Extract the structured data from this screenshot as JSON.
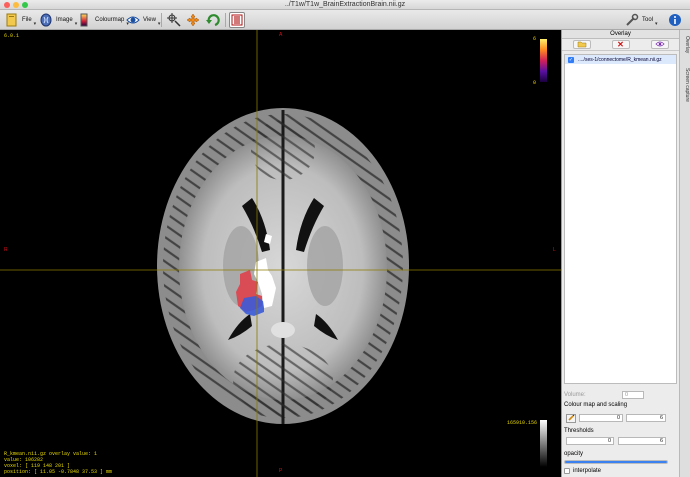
{
  "window": {
    "title": "../T1w/T1w_BrainExtractionBrain.nii.gz"
  },
  "toolbar": {
    "file_label": "File",
    "image_label": "Image",
    "colourmap_label": "Colourmap",
    "view_label": "View",
    "tool_label": "Tool",
    "icons": [
      "file-icon",
      "image-icon",
      "colourmap-icon",
      "view-icon",
      "crosshair-tool-icon",
      "pan-tool-icon",
      "rotate-tool-icon",
      "capture-icon",
      "tool-icon",
      "info-icon"
    ]
  },
  "viewer": {
    "version": "6.0.1",
    "orient_top": "A",
    "orient_left": "R",
    "orient_right": "L",
    "orient_bottom": "P",
    "colourbar_max": "6",
    "colourbar_min": "0",
    "greybar_max": "165910.156",
    "status": {
      "line1": "R_kmean.nii.gz overlay value: 1",
      "line2": "value: 106282",
      "line3": "voxel: [ 119 148 201 ]",
      "line4": "position: [ 11.05 -0.7848 37.53 ] mm"
    },
    "overlay_colors": {
      "red": "#d94b55",
      "blue": "#3b5bd8",
      "white": "#ffffff"
    },
    "crosshair_color": "#8a7a00"
  },
  "overlay_panel": {
    "title": "Overlay",
    "layers": [
      {
        "checked": true,
        "name": "..../ses-1/connectome/R_kmean.nii.gz"
      }
    ],
    "volume_label": "Volume:",
    "volume_value": "0",
    "colour_scaling_label": "Colour map and scaling",
    "scale_min": "0",
    "scale_max": "6",
    "thresholds_label": "Thresholds",
    "threshold_min": "0",
    "threshold_max": "6",
    "opacity_label": "opacity",
    "opacity_value": 1.0,
    "interpolate_label": "interpolate",
    "interpolate_checked": false
  },
  "side_tabs": [
    "Overlay",
    "Screen capture"
  ]
}
